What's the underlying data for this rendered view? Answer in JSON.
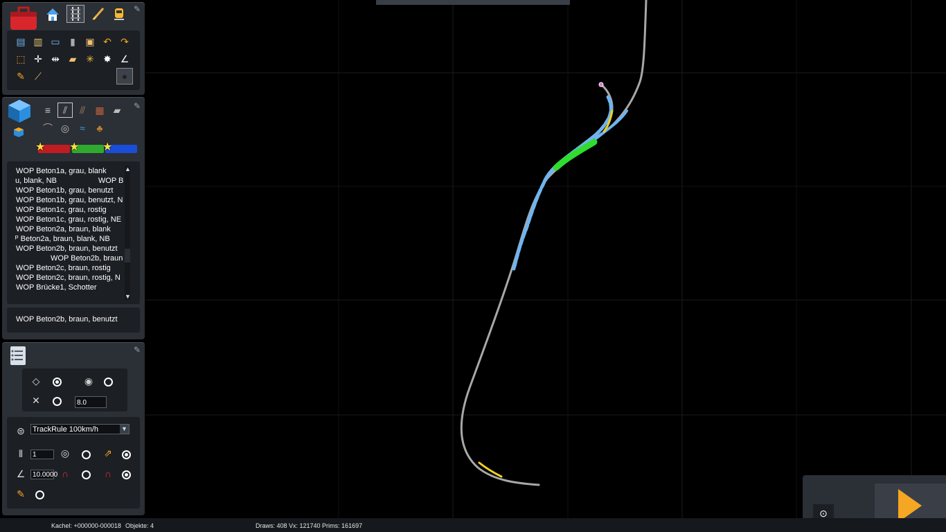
{
  "toolbar_top": {
    "mode_icons": [
      "toolbox-icon",
      "home-icon",
      "track-mode-icon",
      "paint-brush-icon",
      "train-driver-icon"
    ],
    "tools_row1": [
      "copy-icon",
      "paste-icon",
      "screen-icon",
      "trash-icon",
      "clone-icon",
      "undo-icon",
      "redo-icon"
    ],
    "tools_row2": [
      "select-icon",
      "move-icon",
      "split-icon",
      "ruler-icon",
      "sun-icon",
      "compass-icon",
      "angle-icon"
    ],
    "tools_row3": [
      "pencil-icon",
      "measure-icon",
      "sphere-icon"
    ]
  },
  "asset_panel": {
    "categories_row1": [
      "track-icon",
      "rail-icon",
      "fence-icon",
      "brick-icon",
      "platform-icon"
    ],
    "categories_row2": [
      "bridge-icon",
      "tunnel-icon",
      "water-icon",
      "rock-icon"
    ],
    "favorites": [
      "favorite-red",
      "favorite-green",
      "favorite-blue"
    ],
    "items": [
      {
        "label": "WOP Beton1a, grau, blank",
        "indent": 0
      },
      {
        "label": "u, blank, NB",
        "indent": -1,
        "extra": "WOP B"
      },
      {
        "label": "WOP Beton1b, grau, benutzt",
        "indent": 0
      },
      {
        "label": "WOP Beton1b, grau, benutzt, N",
        "indent": 0
      },
      {
        "label": "WOP Beton1c, grau, rostig",
        "indent": 0
      },
      {
        "label": "WOP Beton1c, grau, rostig, NE",
        "indent": 0
      },
      {
        "label": "WOP Beton2a, braun, blank",
        "indent": 0
      },
      {
        "label": "ᴾ Beton2a, braun, blank, NB",
        "indent": -1
      },
      {
        "label": "WOP Beton2b, braun, benutzt",
        "indent": 0
      },
      {
        "label": "WOP Beton2b, braun",
        "indent": 1
      },
      {
        "label": "WOP Beton2c, braun, rostig",
        "indent": 0
      },
      {
        "label": "WOP Beton2c, braun, rostig, N",
        "indent": 0
      },
      {
        "label": "WOP Brücke1, Schotter",
        "indent": 0
      }
    ],
    "selected": "WOP Beton2b, braun, benutzt"
  },
  "properties_panel": {
    "height_value": "8.0",
    "track_rule": "TrackRule 100km/h",
    "track_count": "1",
    "gradient_value": "10.0000"
  },
  "status": {
    "tile": "Kachel: +000000-000018",
    "objects": "Objekte: 4",
    "stats": "Draws: 408 Vx: 121740 Prims: 161697"
  },
  "colors": {
    "panel_bg": "#2b2f36",
    "sub_bg": "#1c1f24",
    "track_gray": "#a8a8a8",
    "track_blue": "#6fb4ef",
    "track_green": "#2fdc2f",
    "track_yellow": "#f0d020",
    "play_orange": "#f5a623"
  }
}
